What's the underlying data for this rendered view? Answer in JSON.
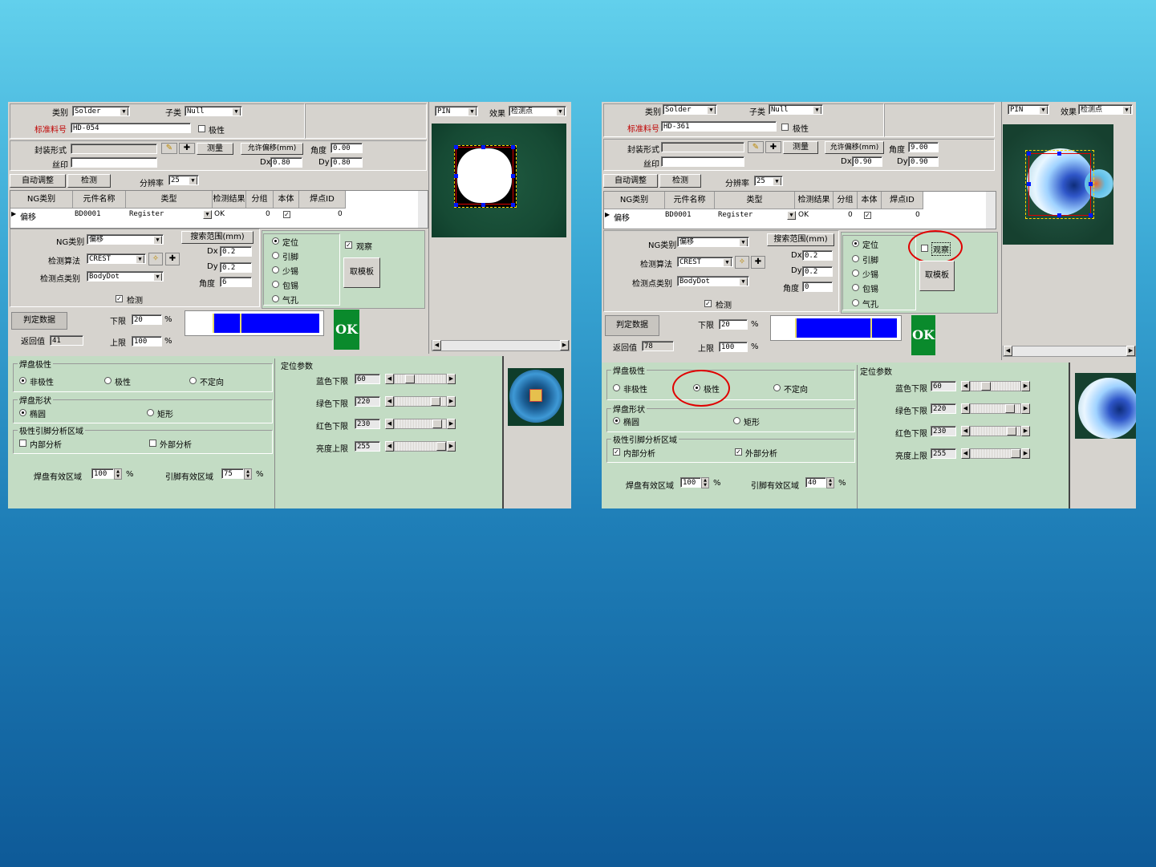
{
  "colors": {
    "accent_blue": "#0000ff",
    "ok_green": "#0a8a2c",
    "panel_green": "#c3dcc4",
    "highlight_red": "#e00000"
  },
  "left": {
    "category_label": "类别",
    "category_value": "Solder",
    "subtype_label": "子类",
    "subtype_value": "Null",
    "std_part_label": "标准料号",
    "std_part_value": "HD-054",
    "polarity_label": "极性",
    "package_label": "封装形式",
    "silk_label": "丝印",
    "measure_btn": "测量",
    "offset_btn": "允许偏移(mm)",
    "angle_label": "角度",
    "angle_value": "0.00",
    "dx_label": "Dx",
    "dx_value": "0.80",
    "dy_label": "Dy",
    "dy_value": "0.80",
    "auto_adjust_btn": "自动调整",
    "detect_btn": "检测",
    "resolution_label": "分辨率",
    "resolution_value": "25",
    "table": {
      "headers": [
        "NG类别",
        "元件名称",
        "类型",
        "检测结果",
        "分组",
        "本体",
        "焊点ID"
      ],
      "row": {
        "ng": "偏移",
        "name": "BD0001",
        "type": "Register",
        "result": "OK",
        "group": "0",
        "id": "0"
      }
    },
    "ng_label": "NG类别",
    "ng_value": "偏移",
    "algo_label": "检测算法",
    "algo_value": "CREST",
    "point_label": "检测点类别",
    "point_value": "BodyDot",
    "detect_chk": "检测",
    "search_btn": "搜索范围(mm)",
    "s_dx_label": "Dx",
    "s_dx": "0.2",
    "s_dy_label": "Dy",
    "s_dy": "0.2",
    "s_angle_label": "角度",
    "s_angle": "6",
    "radios": [
      "定位",
      "引脚",
      "少锡",
      "包锡",
      "气孔"
    ],
    "observe_chk": "观察",
    "template_btn": "取模板",
    "judge_btn": "判定数据",
    "lower_label": "下限",
    "lower_value": "20",
    "upper_label": "上限",
    "upper_value": "100",
    "pct": "%",
    "return_label": "返回值",
    "return_value": "41",
    "ok": "OK",
    "pin_value": "PIN",
    "effect_label": "效果",
    "effect_value": "检测点",
    "pad_pol_title": "焊盘极性",
    "pad_pol_opts": [
      "非极性",
      "极性",
      "不定向"
    ],
    "pad_shape_title": "焊盘形状",
    "pad_shape_opts": [
      "椭圆",
      "矩形"
    ],
    "lead_title": "极性引脚分析区域",
    "lead_opts": [
      "内部分析",
      "外部分析"
    ],
    "pad_area_label": "焊盘有效区域",
    "pad_area_value": "100",
    "lead_area_label": "引脚有效区域",
    "lead_area_value": "75",
    "loc_title": "定位参数",
    "sliders": [
      {
        "label": "蓝色下限",
        "value": "60",
        "level": 0.25
      },
      {
        "label": "绿色下限",
        "value": "220",
        "level": 0.86
      },
      {
        "label": "红色下限",
        "value": "230",
        "level": 0.9
      },
      {
        "label": "亮度上限",
        "value": "255",
        "level": 1.0
      }
    ]
  },
  "right": {
    "category_label": "类别",
    "category_value": "Solder",
    "subtype_label": "子类",
    "subtype_value": "Null",
    "std_part_label": "标准料号",
    "std_part_value": "HD-361",
    "polarity_label": "极性",
    "package_label": "封装形式",
    "silk_label": "丝印",
    "measure_btn": "测量",
    "offset_btn": "允许偏移(mm)",
    "angle_label": "角度",
    "angle_value": "9.00",
    "dx_label": "Dx",
    "dx_value": "0.90",
    "dy_label": "Dy",
    "dy_value": "0.90",
    "auto_adjust_btn": "自动调整",
    "detect_btn": "检测",
    "resolution_label": "分辨率",
    "resolution_value": "25",
    "table": {
      "headers": [
        "NG类别",
        "元件名称",
        "类型",
        "检测结果",
        "分组",
        "本体",
        "焊点ID"
      ],
      "row": {
        "ng": "偏移",
        "name": "BD0001",
        "type": "Register",
        "result": "OK",
        "group": "0",
        "id": "0"
      }
    },
    "ng_label": "NG类别",
    "ng_value": "偏移",
    "algo_label": "检测算法",
    "algo_value": "CREST",
    "point_label": "检测点类别",
    "point_value": "BodyDot",
    "detect_chk": "检测",
    "search_btn": "搜索范围(mm)",
    "s_dx_label": "Dx",
    "s_dx": "0.2",
    "s_dy_label": "Dy",
    "s_dy": "0.2",
    "s_angle_label": "角度",
    "s_angle": "0",
    "radios": [
      "定位",
      "引脚",
      "少锡",
      "包锡",
      "气孔"
    ],
    "observe_chk": "观察",
    "template_btn": "取模板",
    "judge_btn": "判定数据",
    "lower_label": "下限",
    "lower_value": "20",
    "upper_label": "上限",
    "upper_value": "100",
    "pct": "%",
    "return_label": "返回值",
    "return_value": "78",
    "ok": "OK",
    "pin_value": "PIN",
    "effect_label": "效果",
    "effect_value": "检测点",
    "pad_pol_title": "焊盘极性",
    "pad_pol_opts": [
      "非极性",
      "极性",
      "不定向"
    ],
    "pad_shape_title": "焊盘形状",
    "pad_shape_opts": [
      "椭圆",
      "矩形"
    ],
    "lead_title": "极性引脚分析区域",
    "lead_opts": [
      "内部分析",
      "外部分析"
    ],
    "pad_area_label": "焊盘有效区域",
    "pad_area_value": "100",
    "lead_area_label": "引脚有效区域",
    "lead_area_value": "40",
    "loc_title": "定位参数",
    "sliders": [
      {
        "label": "蓝色下限",
        "value": "60",
        "level": 0.25
      },
      {
        "label": "绿色下限",
        "value": "220",
        "level": 0.86
      },
      {
        "label": "红色下限",
        "value": "230",
        "level": 0.9
      },
      {
        "label": "亮度上限",
        "value": "255",
        "level": 1.0
      }
    ]
  }
}
